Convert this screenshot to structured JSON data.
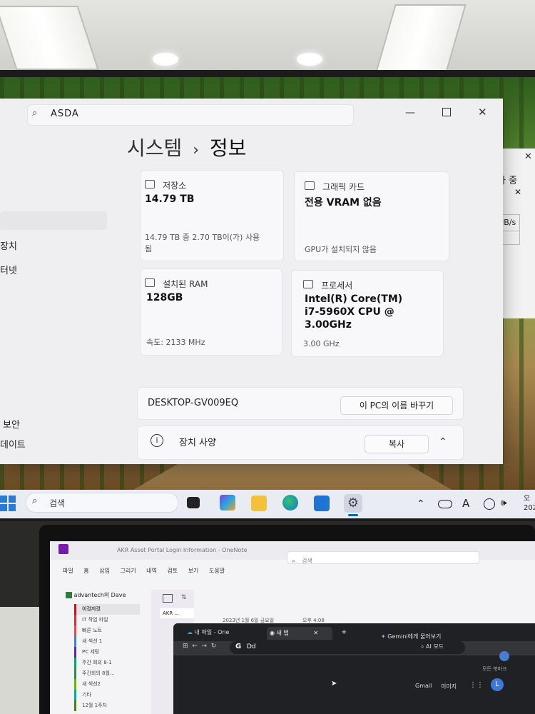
{
  "settings": {
    "search_query": "ASDA",
    "breadcrumb": {
      "section": "시스템",
      "separator": "›",
      "page": "정보"
    },
    "left_nav_partial": [
      "장치",
      "터넷",
      "보안",
      "데이트"
    ],
    "specs": {
      "storage": {
        "label": "저장소",
        "value": "14.79 TB",
        "detail": "14.79 TB 중 2.70 TB이(가) 사용됨"
      },
      "graphics": {
        "label": "그래픽 카드",
        "value": "전용 VRAM 없음",
        "detail": "GPU가 설치되지 않음"
      },
      "ram": {
        "label": "설치된 RAM",
        "value": "128GB",
        "detail": "속도: 2133 MHz"
      },
      "cpu": {
        "label": "프로세서",
        "value_line1": "Intel(R) Core(TM)",
        "value_line2": "i7-5960X CPU @",
        "value_line3": "3.00GHz",
        "detail": "3.00 GHz"
      }
    },
    "device_name": "DESKTOP-GV009EQ",
    "rename_button": "이 PC의 이름 바꾸기",
    "device_spec_label": "장치 사양",
    "copy_button": "복사",
    "back_window_partial": {
      "title": "사 중",
      "cell": "MB/s"
    }
  },
  "taskbar": {
    "search_placeholder": "검색",
    "tray_letter": "A",
    "clock_partial": "오\n202"
  },
  "onenote": {
    "title": "AKR Asset Portal Login Information - OneNote",
    "search_placeholder": "검색",
    "menu": [
      "파일",
      "홈",
      "삽입",
      "그리기",
      "내역",
      "검토",
      "보기",
      "도움말"
    ],
    "notebook": "advantech의 Dave",
    "sections": [
      "이것저것",
      "IT 작업 파일",
      "빠른 노트",
      "새 섹션 1",
      "PC 세팅",
      "주간 회의 8-1",
      "주간회의 8월...",
      "새 섹션2",
      "기타",
      "12월 1주차"
    ],
    "page_tab": "AKR ...",
    "page_date": "2023년 1월 6일 금요일",
    "page_time": "오후 4:08"
  },
  "chrome": {
    "tabs": [
      "내 파일 - One",
      "새 탭"
    ],
    "gemini": "Gemini에게 물어보기",
    "address": "Dd",
    "ai_mode": "AI 모드",
    "links": [
      "Gmail",
      "이미지"
    ],
    "profile_initial": "L",
    "extra": "모든 북마크"
  },
  "colors": {
    "accent": "#0067c0",
    "window_bg": "#efeff1",
    "taskbar_bg": "#e9ecf2"
  }
}
